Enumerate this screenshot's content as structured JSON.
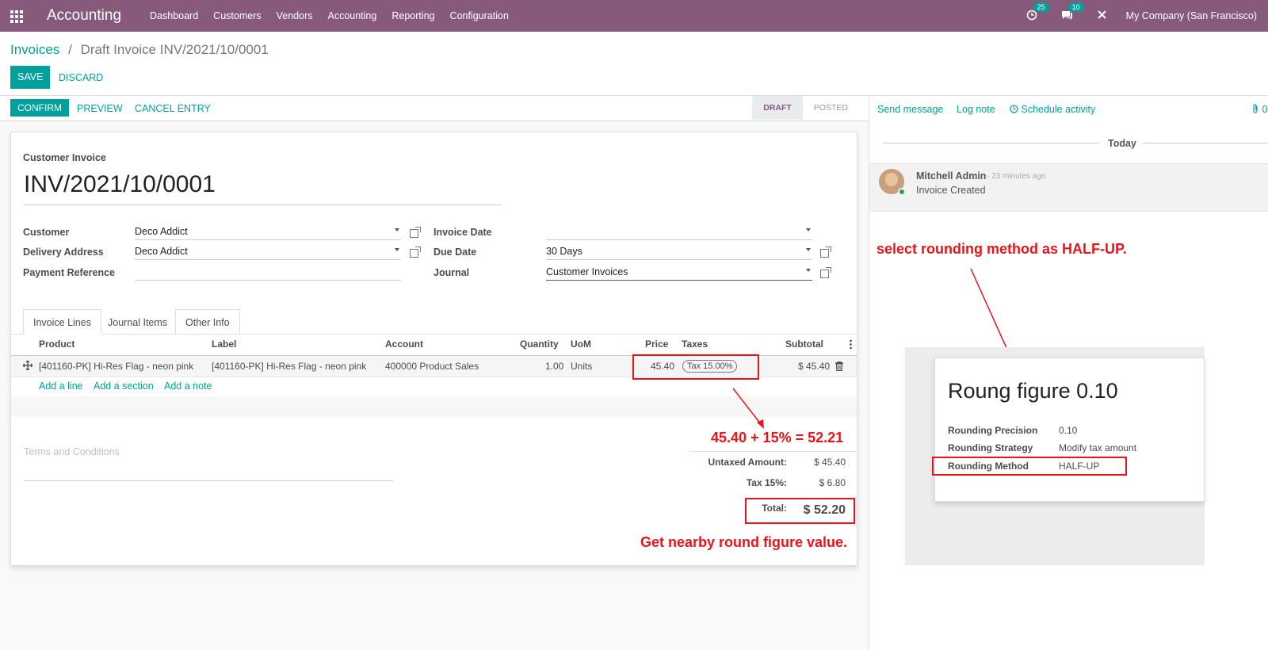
{
  "navbar": {
    "brand": "Accounting",
    "menu": [
      "Dashboard",
      "Customers",
      "Vendors",
      "Accounting",
      "Reporting",
      "Configuration"
    ],
    "activity_count": "25",
    "message_count": "10",
    "company": "My Company (San Francisco)"
  },
  "breadcrumb": {
    "parent": "Invoices",
    "separator": "/",
    "current": "Draft Invoice INV/2021/10/0001"
  },
  "actions": {
    "save": "SAVE",
    "discard": "DISCARD"
  },
  "statusbar": {
    "buttons": {
      "confirm": "CONFIRM",
      "preview": "PREVIEW",
      "cancel": "CANCEL ENTRY"
    },
    "steps": [
      "DRAFT",
      "POSTED"
    ],
    "active_step": "DRAFT"
  },
  "invoice": {
    "type_label": "Customer Invoice",
    "number": "INV/2021/10/0001",
    "fields": {
      "customer_label": "Customer",
      "customer": "Deco Addict",
      "delivery_label": "Delivery Address",
      "delivery": "Deco Addict",
      "payment_ref_label": "Payment Reference",
      "payment_ref": "",
      "invoice_date_label": "Invoice Date",
      "invoice_date": "",
      "due_date_label": "Due Date",
      "due_date": "30 Days",
      "journal_label": "Journal",
      "journal": "Customer Invoices"
    },
    "tabs": [
      "Invoice Lines",
      "Journal Items",
      "Other Info"
    ],
    "columns": [
      "Product",
      "Label",
      "Account",
      "Quantity",
      "UoM",
      "Price",
      "Taxes",
      "Subtotal"
    ],
    "lines": [
      {
        "product": "[401160-PK] Hi-Res Flag - neon pink",
        "label": "[401160-PK] Hi-Res Flag - neon pink",
        "account": "400000 Product Sales",
        "quantity": "1.00",
        "uom": "Units",
        "price": "45.40",
        "tax": "Tax 15.00%",
        "subtotal": "$ 45.40"
      }
    ],
    "add_links": [
      "Add a line",
      "Add a section",
      "Add a note"
    ],
    "terms_placeholder": "Terms and Conditions",
    "totals": {
      "untaxed_label": "Untaxed Amount:",
      "untaxed": "$ 45.40",
      "tax_label": "Tax 15%:",
      "tax": "$ 6.80",
      "total_label": "Total:",
      "total": "$ 52.20"
    }
  },
  "annotations": {
    "calc": "45.40 + 15% = 52.21",
    "round_note": "Get nearby round figure value.",
    "select_note": "select rounding method as HALF-UP.",
    "color": "#e8141a"
  },
  "chatter": {
    "send_message": "Send message",
    "log_note": "Log note",
    "schedule_activity": "Schedule activity",
    "attachment_count": "0",
    "date_separator": "Today",
    "message": {
      "author": "Mitchell Admin",
      "time": "- 23 minutes ago",
      "body": "Invoice Created"
    }
  },
  "rounding": {
    "title": "Roung figure 0.10",
    "precision_label": "Rounding Precision",
    "precision": "0.10",
    "strategy_label": "Rounding Strategy",
    "strategy": "Modify tax amount",
    "method_label": "Rounding Method",
    "method": "HALF-UP"
  },
  "colors": {
    "brand": "#875a7b",
    "accent": "#00a09d"
  }
}
